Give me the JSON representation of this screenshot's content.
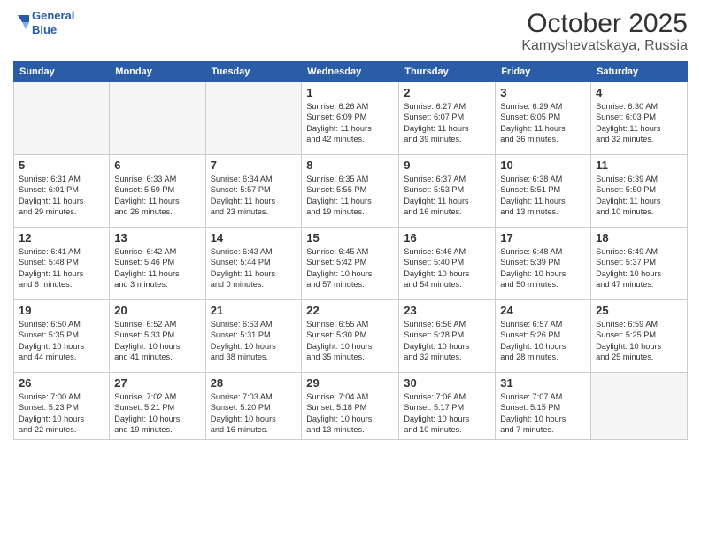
{
  "logo": {
    "line1": "General",
    "line2": "Blue"
  },
  "title": "October 2025",
  "location": "Kamyshevatskaya, Russia",
  "weekdays": [
    "Sunday",
    "Monday",
    "Tuesday",
    "Wednesday",
    "Thursday",
    "Friday",
    "Saturday"
  ],
  "weeks": [
    [
      {
        "day": "",
        "info": ""
      },
      {
        "day": "",
        "info": ""
      },
      {
        "day": "",
        "info": ""
      },
      {
        "day": "1",
        "info": "Sunrise: 6:26 AM\nSunset: 6:09 PM\nDaylight: 11 hours\nand 42 minutes."
      },
      {
        "day": "2",
        "info": "Sunrise: 6:27 AM\nSunset: 6:07 PM\nDaylight: 11 hours\nand 39 minutes."
      },
      {
        "day": "3",
        "info": "Sunrise: 6:29 AM\nSunset: 6:05 PM\nDaylight: 11 hours\nand 36 minutes."
      },
      {
        "day": "4",
        "info": "Sunrise: 6:30 AM\nSunset: 6:03 PM\nDaylight: 11 hours\nand 32 minutes."
      }
    ],
    [
      {
        "day": "5",
        "info": "Sunrise: 6:31 AM\nSunset: 6:01 PM\nDaylight: 11 hours\nand 29 minutes."
      },
      {
        "day": "6",
        "info": "Sunrise: 6:33 AM\nSunset: 5:59 PM\nDaylight: 11 hours\nand 26 minutes."
      },
      {
        "day": "7",
        "info": "Sunrise: 6:34 AM\nSunset: 5:57 PM\nDaylight: 11 hours\nand 23 minutes."
      },
      {
        "day": "8",
        "info": "Sunrise: 6:35 AM\nSunset: 5:55 PM\nDaylight: 11 hours\nand 19 minutes."
      },
      {
        "day": "9",
        "info": "Sunrise: 6:37 AM\nSunset: 5:53 PM\nDaylight: 11 hours\nand 16 minutes."
      },
      {
        "day": "10",
        "info": "Sunrise: 6:38 AM\nSunset: 5:51 PM\nDaylight: 11 hours\nand 13 minutes."
      },
      {
        "day": "11",
        "info": "Sunrise: 6:39 AM\nSunset: 5:50 PM\nDaylight: 11 hours\nand 10 minutes."
      }
    ],
    [
      {
        "day": "12",
        "info": "Sunrise: 6:41 AM\nSunset: 5:48 PM\nDaylight: 11 hours\nand 6 minutes."
      },
      {
        "day": "13",
        "info": "Sunrise: 6:42 AM\nSunset: 5:46 PM\nDaylight: 11 hours\nand 3 minutes."
      },
      {
        "day": "14",
        "info": "Sunrise: 6:43 AM\nSunset: 5:44 PM\nDaylight: 11 hours\nand 0 minutes."
      },
      {
        "day": "15",
        "info": "Sunrise: 6:45 AM\nSunset: 5:42 PM\nDaylight: 10 hours\nand 57 minutes."
      },
      {
        "day": "16",
        "info": "Sunrise: 6:46 AM\nSunset: 5:40 PM\nDaylight: 10 hours\nand 54 minutes."
      },
      {
        "day": "17",
        "info": "Sunrise: 6:48 AM\nSunset: 5:39 PM\nDaylight: 10 hours\nand 50 minutes."
      },
      {
        "day": "18",
        "info": "Sunrise: 6:49 AM\nSunset: 5:37 PM\nDaylight: 10 hours\nand 47 minutes."
      }
    ],
    [
      {
        "day": "19",
        "info": "Sunrise: 6:50 AM\nSunset: 5:35 PM\nDaylight: 10 hours\nand 44 minutes."
      },
      {
        "day": "20",
        "info": "Sunrise: 6:52 AM\nSunset: 5:33 PM\nDaylight: 10 hours\nand 41 minutes."
      },
      {
        "day": "21",
        "info": "Sunrise: 6:53 AM\nSunset: 5:31 PM\nDaylight: 10 hours\nand 38 minutes."
      },
      {
        "day": "22",
        "info": "Sunrise: 6:55 AM\nSunset: 5:30 PM\nDaylight: 10 hours\nand 35 minutes."
      },
      {
        "day": "23",
        "info": "Sunrise: 6:56 AM\nSunset: 5:28 PM\nDaylight: 10 hours\nand 32 minutes."
      },
      {
        "day": "24",
        "info": "Sunrise: 6:57 AM\nSunset: 5:26 PM\nDaylight: 10 hours\nand 28 minutes."
      },
      {
        "day": "25",
        "info": "Sunrise: 6:59 AM\nSunset: 5:25 PM\nDaylight: 10 hours\nand 25 minutes."
      }
    ],
    [
      {
        "day": "26",
        "info": "Sunrise: 7:00 AM\nSunset: 5:23 PM\nDaylight: 10 hours\nand 22 minutes."
      },
      {
        "day": "27",
        "info": "Sunrise: 7:02 AM\nSunset: 5:21 PM\nDaylight: 10 hours\nand 19 minutes."
      },
      {
        "day": "28",
        "info": "Sunrise: 7:03 AM\nSunset: 5:20 PM\nDaylight: 10 hours\nand 16 minutes."
      },
      {
        "day": "29",
        "info": "Sunrise: 7:04 AM\nSunset: 5:18 PM\nDaylight: 10 hours\nand 13 minutes."
      },
      {
        "day": "30",
        "info": "Sunrise: 7:06 AM\nSunset: 5:17 PM\nDaylight: 10 hours\nand 10 minutes."
      },
      {
        "day": "31",
        "info": "Sunrise: 7:07 AM\nSunset: 5:15 PM\nDaylight: 10 hours\nand 7 minutes."
      },
      {
        "day": "",
        "info": ""
      }
    ]
  ]
}
